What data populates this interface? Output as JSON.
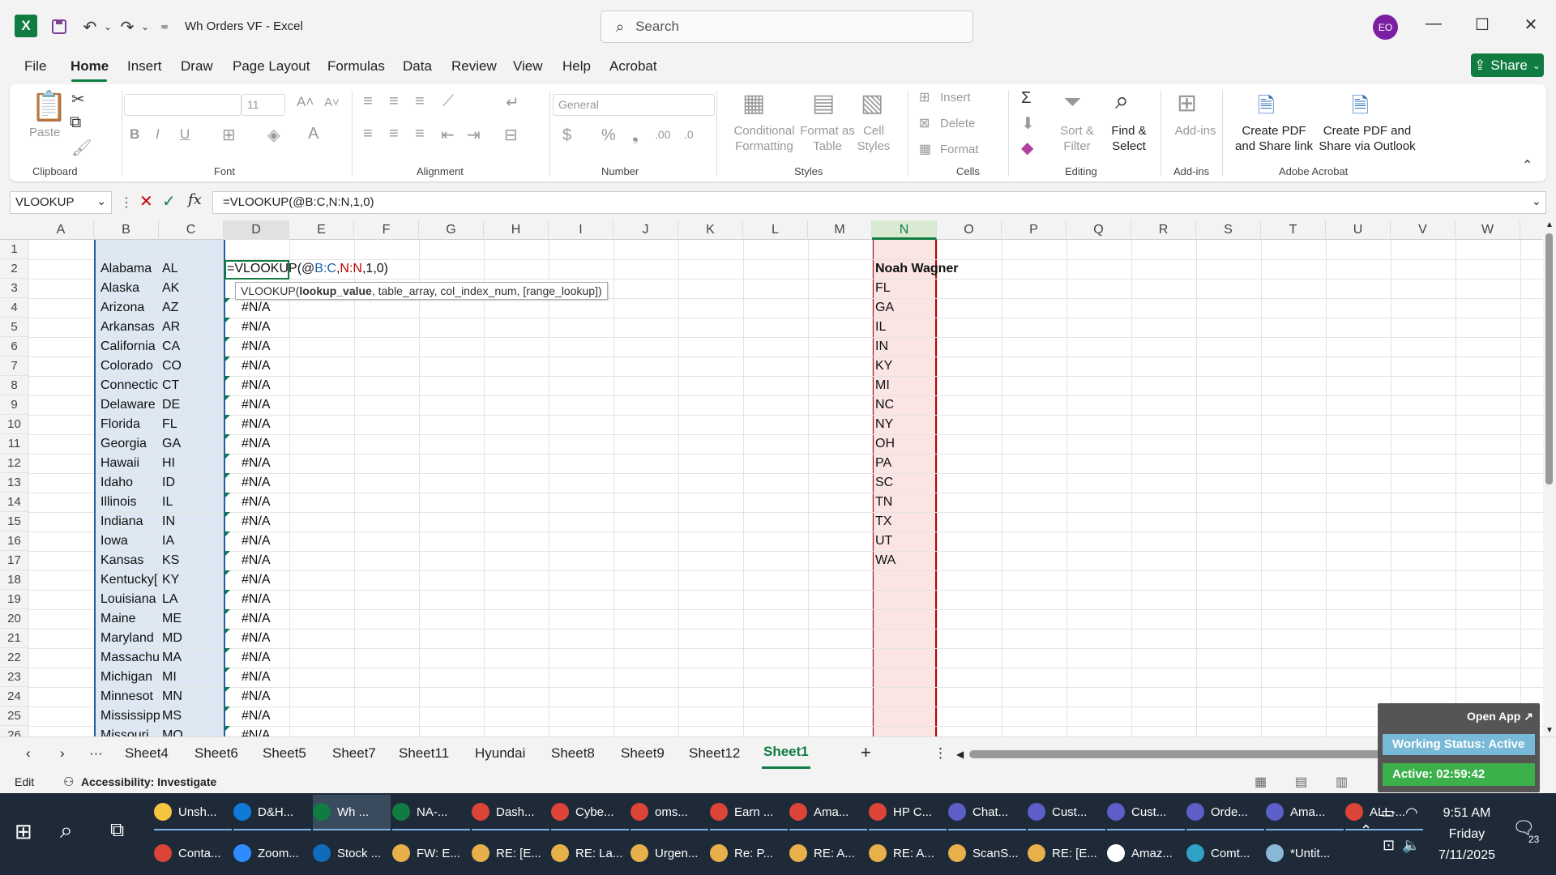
{
  "titlebar": {
    "doc_title": "Wh Orders VF  -  Excel",
    "search_placeholder": "Search",
    "avatar_initials": "EO",
    "share_label": "Share"
  },
  "menu": [
    "File",
    "Home",
    "Insert",
    "Draw",
    "Page Layout",
    "Formulas",
    "Data",
    "Review",
    "View",
    "Help",
    "Acrobat"
  ],
  "ribbon": {
    "paste": "Paste",
    "font_size": "11",
    "number_format": "General",
    "conditional": "Conditional\nFormatting",
    "format_table": "Format as\nTable",
    "cell_styles": "Cell\nStyles",
    "insert": "Insert",
    "delete": "Delete",
    "format": "Format",
    "sort_filter": "Sort &\nFilter",
    "find_select": "Find &\nSelect",
    "addins": "Add-ins",
    "create_pdf_share": "Create PDF\nand Share link",
    "create_pdf_outlook": "Create PDF and\nShare via Outlook",
    "groups": {
      "clipboard": "Clipboard",
      "font": "Font",
      "alignment": "Alignment",
      "number": "Number",
      "styles": "Styles",
      "cells": "Cells",
      "editing": "Editing",
      "addins": "Add-ins",
      "acrobat": "Adobe Acrobat"
    }
  },
  "formula_bar": {
    "name_box": "VLOOKUP",
    "formula": "=VLOOKUP(@B:C,N:N,1,0)"
  },
  "columns": [
    "A",
    "B",
    "C",
    "D",
    "E",
    "F",
    "G",
    "H",
    "I",
    "J",
    "K",
    "L",
    "M",
    "N",
    "O",
    "P",
    "Q",
    "R",
    "S",
    "T",
    "U",
    "V",
    "W"
  ],
  "rows": [
    "1",
    "2",
    "3",
    "4",
    "5",
    "6",
    "7",
    "8",
    "9",
    "10",
    "11",
    "12",
    "13",
    "14",
    "15",
    "16",
    "17",
    "18",
    "19",
    "20",
    "21",
    "22",
    "23",
    "24",
    "25",
    "26"
  ],
  "cell_d2": {
    "prefix": "=VLOOKUP(@",
    "ref1": "B:C",
    "comma": ",",
    "ref2": "N:N",
    "suffix": ",1,0)"
  },
  "tooltip": {
    "fn": "VLOOKUP(",
    "arg": "lookup_value",
    "rest": ", table_array, col_index_num, [range_lookup])"
  },
  "states": [
    [
      "Alabama",
      "AL"
    ],
    [
      "Alaska",
      "AK"
    ],
    [
      "Arizona",
      "AZ"
    ],
    [
      "Arkansas",
      "AR"
    ],
    [
      "California",
      "CA"
    ],
    [
      "Colorado",
      "CO"
    ],
    [
      "Connectic",
      "CT"
    ],
    [
      "Delaware",
      "DE"
    ],
    [
      "Florida",
      "FL"
    ],
    [
      "Georgia",
      "GA"
    ],
    [
      "Hawaii",
      "HI"
    ],
    [
      "Idaho",
      "ID"
    ],
    [
      "Illinois",
      "IL"
    ],
    [
      "Indiana",
      "IN"
    ],
    [
      "Iowa",
      "IA"
    ],
    [
      "Kansas",
      "KS"
    ],
    [
      "Kentucky[",
      "KY"
    ],
    [
      "Louisiana",
      "LA"
    ],
    [
      "Maine",
      "ME"
    ],
    [
      "Maryland",
      "MD"
    ],
    [
      "Massachu",
      "MA"
    ],
    [
      "Michigan",
      "MI"
    ],
    [
      "Minnesot",
      "MN"
    ],
    [
      "Mississipp",
      "MS"
    ],
    [
      "Missouri",
      "MO"
    ]
  ],
  "na_value": "#N/A",
  "col_n": {
    "header": "Noah Wagner",
    "values": [
      "FL",
      "GA",
      "IL",
      "IN",
      "KY",
      "MI",
      "NC",
      "NY",
      "OH",
      "PA",
      "SC",
      "TN",
      "TX",
      "UT",
      "WA"
    ]
  },
  "sheet_tabs": [
    "Sheet4",
    "Sheet6",
    "Sheet5",
    "Sheet7",
    "Sheet11",
    "Hyundai",
    "Sheet8",
    "Sheet9",
    "Sheet12",
    "Sheet1"
  ],
  "active_tab": "Sheet1",
  "status": {
    "mode": "Edit",
    "accessibility": "Accessibility: Investigate"
  },
  "widget": {
    "open_app": "Open App",
    "working_status": "Working Status: Active",
    "active_time": "Active: 02:59:42"
  },
  "taskbar_row1": [
    "Unsh...",
    "D&H...",
    "Wh ...",
    "NA-...",
    "Dash...",
    "Cybe...",
    "oms...",
    "Earn ...",
    "Ama...",
    "HP C...",
    "Chat...",
    "Cust...",
    "Cust...",
    "Orde...",
    "Ama...",
    "ALL-..."
  ],
  "taskbar_row2": [
    "Conta...",
    "Zoom...",
    "Stock ...",
    "FW: E...",
    "RE: [E...",
    "RE: La...",
    "Urgen...",
    "Re: P...",
    "RE: A...",
    "RE: A...",
    "ScanS...",
    "RE: [E...",
    "Amaz...",
    "Comt...",
    "*Untit..."
  ],
  "clock": {
    "time": "9:51 AM",
    "day": "Friday",
    "date": "7/11/2025",
    "notifications": "23"
  },
  "colors": {
    "accent": "#107c41",
    "ref_blue": "#1f5fa8",
    "ref_red": "#c00000",
    "taskbar": "#1e2a38"
  }
}
